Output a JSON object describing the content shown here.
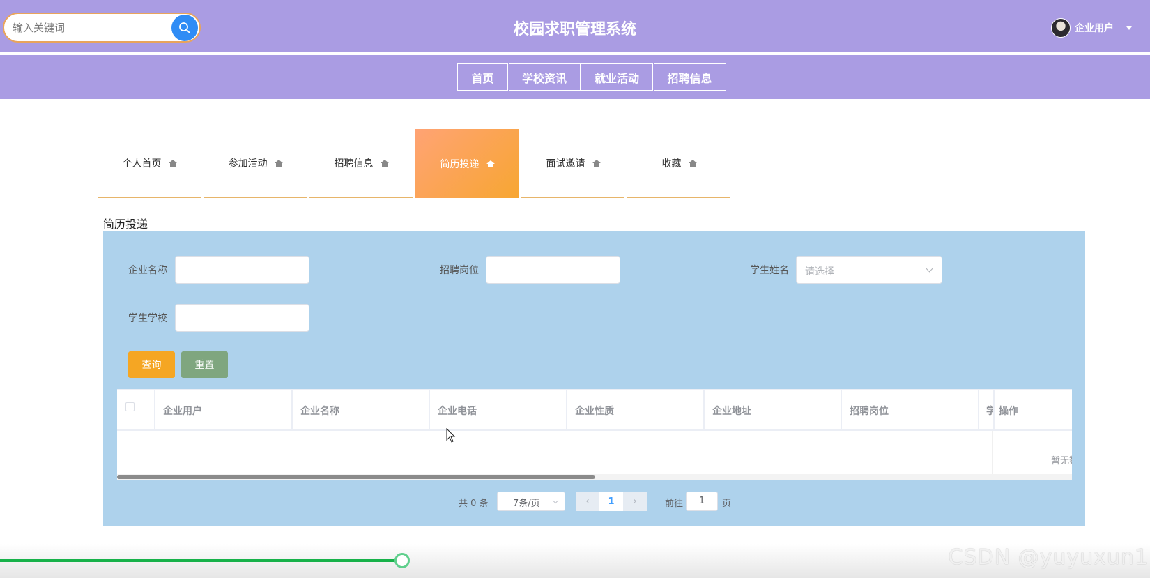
{
  "header": {
    "search_placeholder": "输入关键词",
    "site_title": "校园求职管理系统",
    "user_name": "企业用户"
  },
  "nav": {
    "items": [
      "首页",
      "学校资讯",
      "就业活动",
      "招聘信息"
    ]
  },
  "tabs": {
    "items": [
      "个人首页",
      "参加活动",
      "招聘信息",
      "简历投递",
      "面试邀请",
      "收藏"
    ],
    "active": "简历投递"
  },
  "section_title": "简历投递",
  "filters": {
    "company_name_label": "企业名称",
    "position_label": "招聘岗位",
    "student_name_label": "学生姓名",
    "student_name_placeholder": "请选择",
    "school_label": "学生学校",
    "query_button": "查询",
    "reset_button": "重置"
  },
  "table": {
    "columns": [
      "企业用户",
      "企业名称",
      "企业电话",
      "企业性质",
      "企业地址",
      "招聘岗位",
      "学",
      "操作"
    ],
    "empty_text": "暂无数据"
  },
  "pagination": {
    "total": "共 0 条",
    "page_size": "7条/页",
    "current_page": "1",
    "goto_label": "前往",
    "goto_value": "1",
    "page_unit": "页"
  },
  "video": {
    "progress": 0.35
  },
  "watermark": "CSDN @yuyuxun1",
  "colors": {
    "header_bg": "#aa9ce3",
    "panel_bg": "#aed2ec",
    "active_tab": "#f7a632",
    "query_button": "#f5a623",
    "reset_button": "#7fa67f",
    "search_button": "#2f8cf5"
  }
}
